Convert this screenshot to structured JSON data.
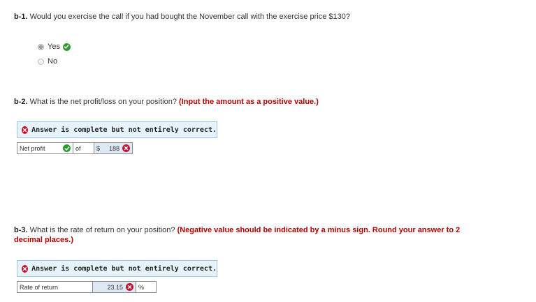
{
  "b1": {
    "num": "b-1.",
    "question": "Would you exercise the call if you had bought the November call with the exercise price $130?",
    "options": [
      {
        "label": "Yes",
        "selected": true,
        "mark": "check-icon"
      },
      {
        "label": "No",
        "selected": false
      }
    ]
  },
  "b2": {
    "num": "b-2.",
    "question": "What is the net profit/loss on your position?",
    "instruction": "(Input the amount as a positive value.)",
    "banner": "Answer is complete but not entirely correct.",
    "row": {
      "label": "Net profit",
      "of": "of",
      "currency": "$",
      "value": "188"
    }
  },
  "b3": {
    "num": "b-3.",
    "question": "What is the rate of return on your position?",
    "instruction_line1": "(Negative value should be indicated by a minus sign. Round your answer to 2",
    "instruction_line2": "decimal places.)",
    "banner": "Answer is complete but not entirely correct.",
    "row": {
      "label": "Rate of return",
      "value": "23.15",
      "unit": "%"
    }
  },
  "colors": {
    "emphasis": "#b30000",
    "correct": "#2e9a2e",
    "incorrect": "#c8102e",
    "banner_bg": "#e7f3fb",
    "banner_border": "#9ec9e6",
    "highlight_cell": "#dfe9f5"
  }
}
